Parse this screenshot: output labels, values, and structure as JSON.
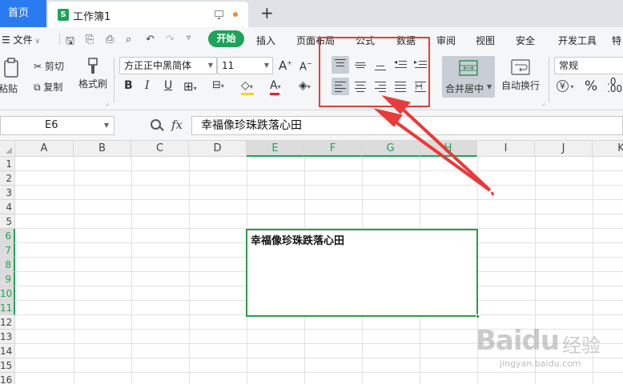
{
  "tabs": {
    "home": "首页",
    "document": "工作簿1",
    "doc_icon_letter": "S",
    "new_tab": "+"
  },
  "menu": {
    "file": "文件",
    "items": [
      "开始",
      "插入",
      "页面布局",
      "公式",
      "数据",
      "审阅",
      "视图",
      "安全",
      "开发工具",
      "特"
    ]
  },
  "ribbon": {
    "paste": "粘贴",
    "cut": "剪切",
    "copy": "复制",
    "format_painter": "格式刷",
    "font_name": "方正正中黑简体",
    "font_size": "11",
    "merge_center": "合并居中",
    "wrap_text": "自动换行",
    "number_format": "常规",
    "currency_symbol": "¥",
    "percent_symbol": "%"
  },
  "formula_bar": {
    "cell_ref": "E6",
    "fx": "fx",
    "content": "幸福像珍珠跌落心田"
  },
  "grid": {
    "columns": [
      "A",
      "B",
      "C",
      "D",
      "E",
      "F",
      "G",
      "H",
      "I",
      "J",
      "K"
    ],
    "rows": [
      "1",
      "2",
      "3",
      "4",
      "5",
      "6",
      "7",
      "8",
      "9",
      "10",
      "11",
      "12",
      "13",
      "14",
      "15",
      "16"
    ],
    "merged_cell_text": "幸福像珍珠跌落心田"
  },
  "watermark": {
    "logo": "Baidu",
    "logo_cn": "经验",
    "url": "jingyan.baidu.com"
  },
  "colors": {
    "accent_green": "#1fa25a",
    "tab_blue": "#2b7bf0",
    "highlight_red": "#e83b3b"
  }
}
